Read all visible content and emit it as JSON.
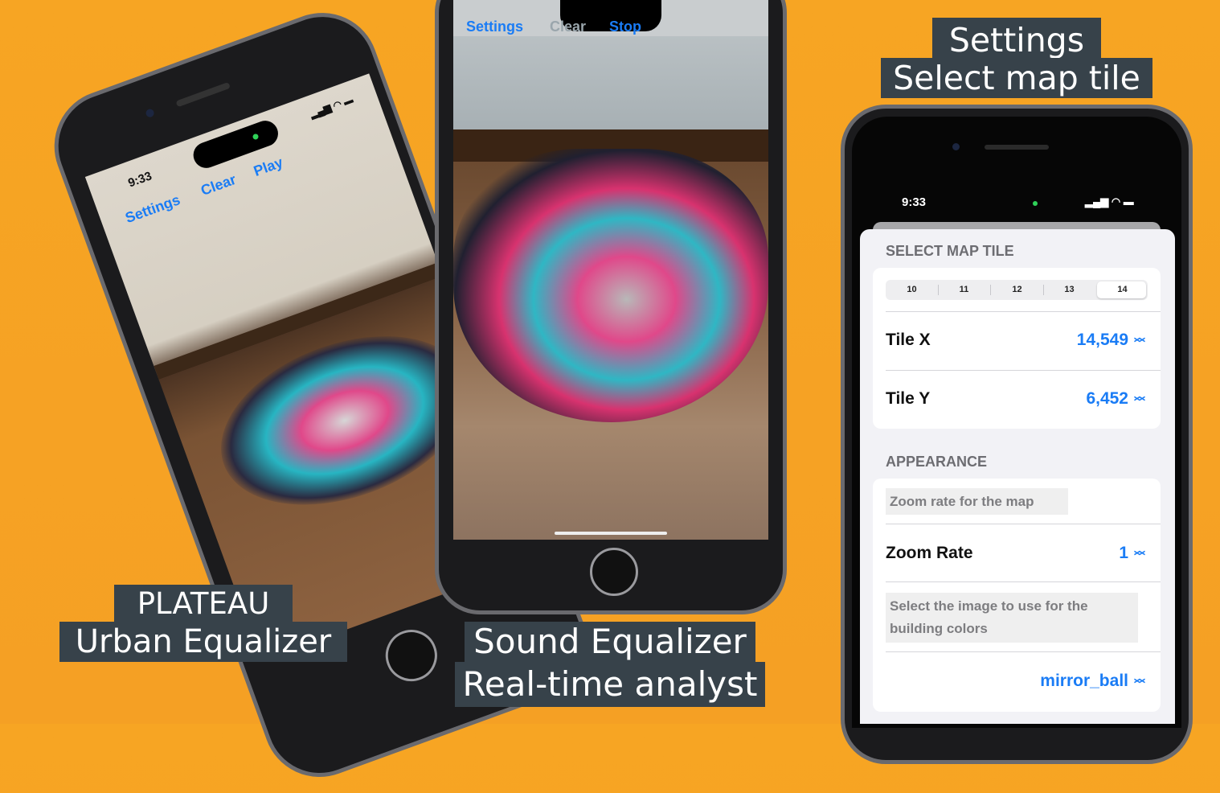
{
  "captions": {
    "left": [
      "PLATEAU",
      "Urban Equalizer"
    ],
    "middle": [
      "Sound Equalizer",
      "Real-time analyst"
    ],
    "right": [
      "Settings",
      "Select map tile"
    ]
  },
  "left_phone": {
    "time": "9:33",
    "toolbar": [
      "Settings",
      "Clear",
      "Play"
    ]
  },
  "middle_phone": {
    "toolbar": [
      "Settings",
      "Clear",
      "Stop"
    ]
  },
  "right_phone": {
    "time": "9:33",
    "section_map": "SELECT MAP TILE",
    "tile_levels": [
      "10",
      "11",
      "12",
      "13",
      "14"
    ],
    "selected_level": "14",
    "tile_x_label": "Tile X",
    "tile_x_value": "14,549",
    "tile_y_label": "Tile Y",
    "tile_y_value": "6,452",
    "section_appearance": "APPEARANCE",
    "zoom_hint": "Zoom rate for the map",
    "zoom_label": "Zoom Rate",
    "zoom_value": "1",
    "image_hint": "Select the image to use for the building colors",
    "image_value": "mirror_ball"
  },
  "colors": {
    "background": "#f7a523",
    "caption_bg": "#37424a",
    "ios_blue": "#1a7cf5"
  }
}
